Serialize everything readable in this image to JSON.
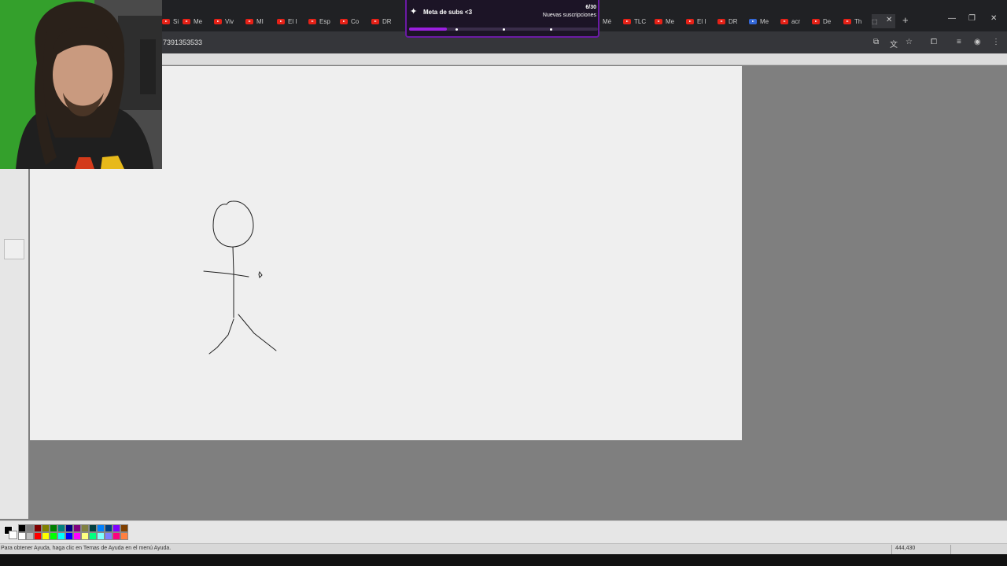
{
  "browser": {
    "tabs": [
      {
        "label": "Si"
      },
      {
        "label": "Me"
      },
      {
        "label": "Viv"
      },
      {
        "label": "MI"
      },
      {
        "label": "El I"
      },
      {
        "label": "Esp"
      },
      {
        "label": "Co"
      },
      {
        "label": "DR"
      },
      {
        "label": "Mé"
      },
      {
        "label": "TLC"
      },
      {
        "label": "Me"
      },
      {
        "label": "El I"
      },
      {
        "label": "DR"
      },
      {
        "label": "Me"
      },
      {
        "label": "acr"
      },
      {
        "label": "De"
      },
      {
        "label": "Th"
      }
    ],
    "new_tab_label": "+",
    "close_tab_label": "✕",
    "window_controls": {
      "minimize": "—",
      "restore": "❐",
      "close": "✕"
    },
    "url": "7391353533"
  },
  "subs_goal": {
    "title": "Meta de subs <3",
    "count": "6/30",
    "subtitle": "Nuevas suscripciones",
    "progress": 0.2
  },
  "paint": {
    "status_text": "Para obtener Ayuda, haga clic en Temas de Ayuda en el menú Ayuda.",
    "coordinates": "444,430",
    "palette_colors": [
      "#000000",
      "#808080",
      "#800000",
      "#808000",
      "#008000",
      "#008080",
      "#000080",
      "#800080",
      "#808040",
      "#004040",
      "#0080ff",
      "#004080",
      "#8000ff",
      "#804000",
      "#ffffff",
      "#c0c0c0",
      "#ff0000",
      "#ffff00",
      "#00ff00",
      "#00ffff",
      "#0000ff",
      "#ff00ff",
      "#ffff80",
      "#00ff80",
      "#80ffff",
      "#8080ff",
      "#ff0080",
      "#ff8040"
    ]
  },
  "colors": {
    "accent_purple": "#9b1fe0",
    "canvas": "#efefef",
    "workspace": "#7f7f7f"
  }
}
